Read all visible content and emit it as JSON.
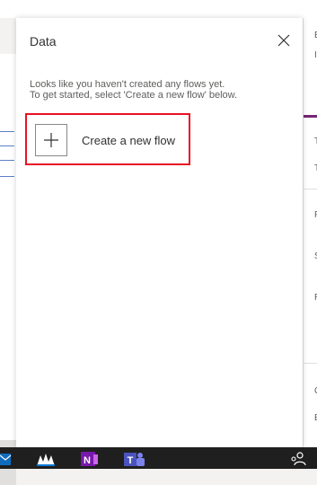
{
  "panel": {
    "title": "Data",
    "close_icon": "close-icon",
    "info_line1": "Looks like you haven't created any flows yet.",
    "info_line2": "To get started, select 'Create a new flow' below.",
    "create_flow": {
      "label": "Create a new flow",
      "icon": "plus-icon"
    }
  },
  "right_pane": {
    "marks": [
      "E",
      "I",
      "T",
      "T",
      "P",
      "S",
      "R",
      "C",
      "E"
    ]
  },
  "taskbar": {
    "icons": [
      "outlook-icon",
      "whiteboard-icon",
      "onenote-icon",
      "teams-icon",
      "people-icon"
    ],
    "onenote_letter": "N",
    "teams_letter": "T"
  },
  "colors": {
    "highlight": "#e81123",
    "accent": "#742774",
    "taskbar": "#1f1f1f"
  }
}
